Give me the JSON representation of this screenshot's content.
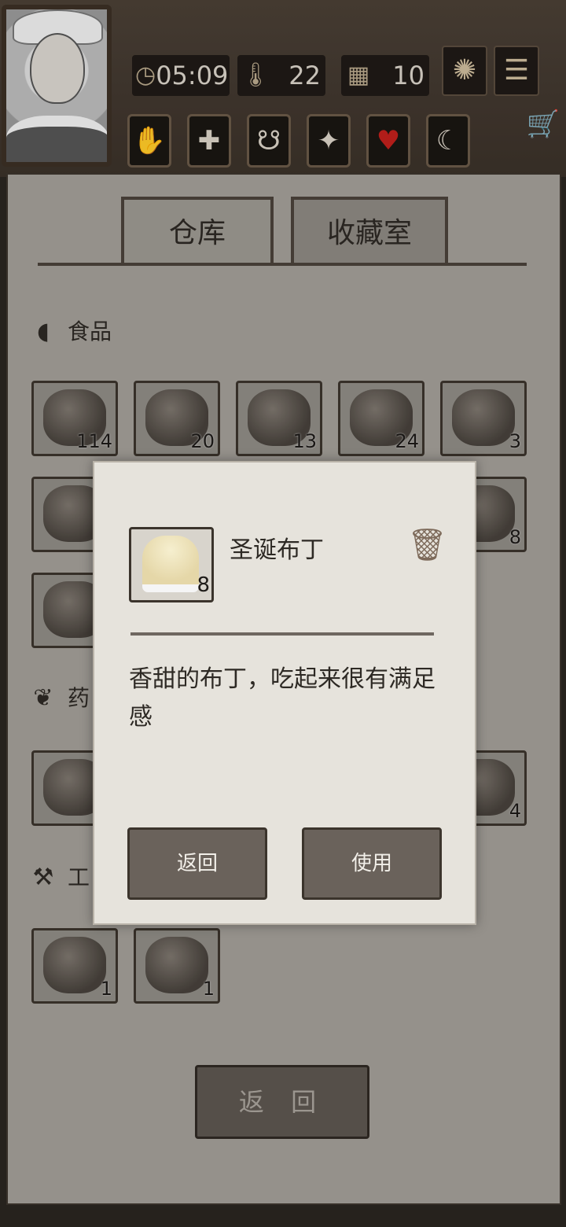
{
  "hud": {
    "time": "05:09",
    "temperature": "22",
    "day": "10",
    "icons": [
      "clock-icon",
      "thermometer-icon",
      "calendar-icon",
      "leaf-icon",
      "menu-icon"
    ],
    "status_icons": [
      "hand-icon",
      "health-icon",
      "stomach-icon",
      "mind-icon",
      "heart-icon",
      "moon-icon"
    ]
  },
  "tabs": [
    {
      "label": "仓库"
    },
    {
      "label": "收藏室"
    }
  ],
  "sections": {
    "food": {
      "label": "食品"
    },
    "medicine": {
      "label": "药"
    },
    "tools": {
      "label": "工"
    }
  },
  "food_row1": [
    {
      "count": "114"
    },
    {
      "count": "20"
    },
    {
      "count": "13"
    },
    {
      "count": "24"
    },
    {
      "count": "3"
    }
  ],
  "food_row2_right": {
    "count": "8"
  },
  "medicine_right": {
    "count": "4"
  },
  "tools": [
    {
      "count": "1"
    },
    {
      "count": "1"
    }
  ],
  "footer": {
    "return_label": "返 回"
  },
  "dialog": {
    "item_name": "圣诞布丁",
    "item_count": "8",
    "description": "香甜的布丁，吃起来很有满足感",
    "back_label": "返回",
    "use_label": "使用"
  },
  "colors": {
    "panel": "#a29e97",
    "dialog": "#e6e3dc",
    "button": "#6a625b"
  }
}
